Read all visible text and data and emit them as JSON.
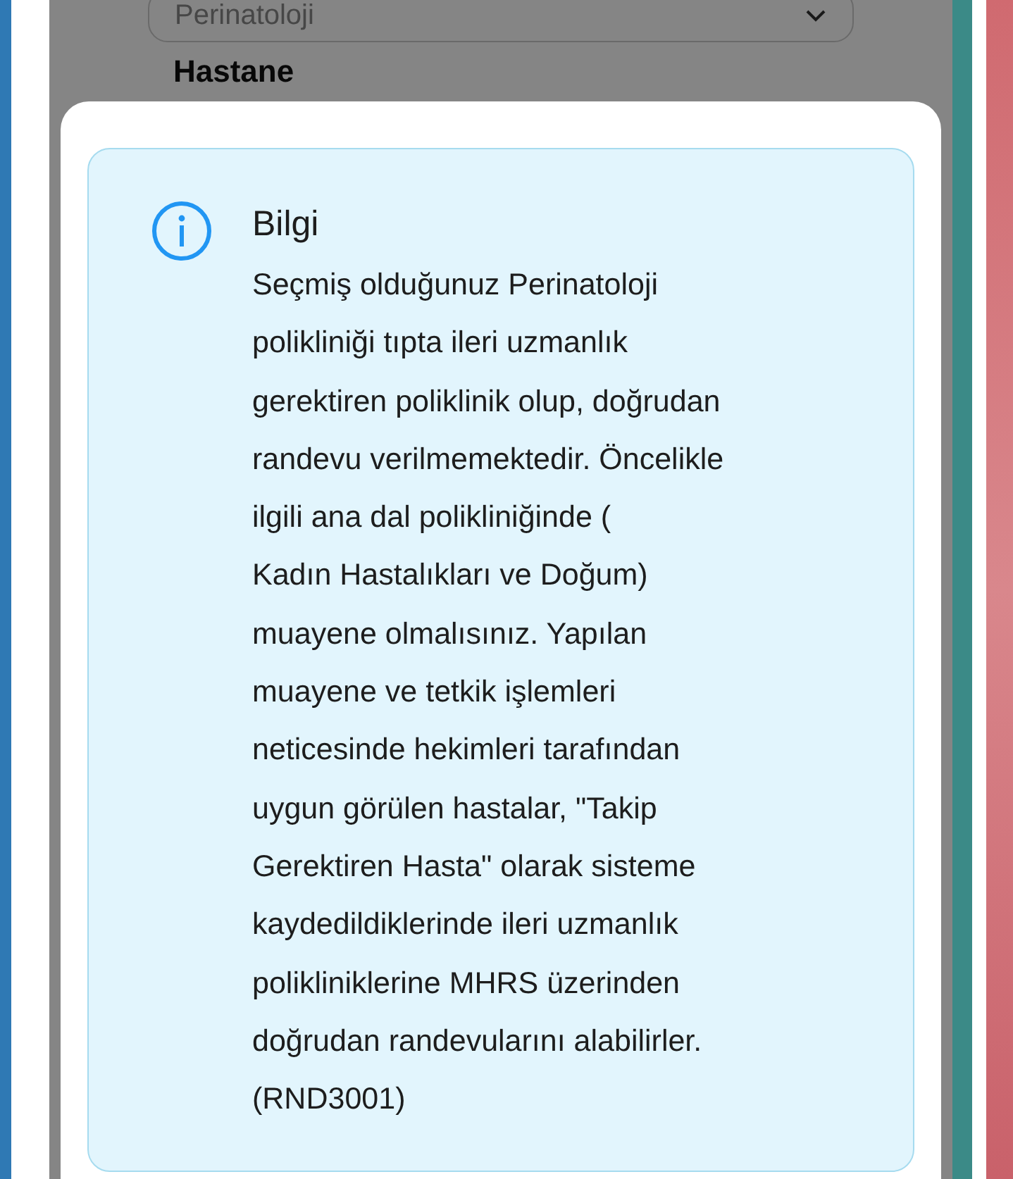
{
  "background_form": {
    "select_value": "Perinatoloji",
    "next_label": "Hastane"
  },
  "dialog": {
    "info": {
      "title": "Bilgi",
      "lines": [
        "Seçmiş olduğunuz Perinatoloji",
        "polikliniği tıpta ileri uzmanlık",
        "gerektiren poliklinik olup, doğrudan",
        "randevu verilmemektedir. Öncelikle",
        "ilgili ana dal polikliniğinde (",
        "Kadın Hastalıkları ve Doğum)",
        "muayene olmalısınız. Yapılan",
        "muayene ve tetkik işlemleri",
        "neticesinde hekimleri tarafından",
        "uygun görülen hastalar, \"Takip",
        "Gerektiren Hasta\" olarak sisteme",
        "kaydedildiklerinde ileri uzmanlık",
        "polikliniklerine MHRS üzerinden",
        "doğrudan randevularını alabilirler.",
        "(RND3001)"
      ]
    }
  }
}
